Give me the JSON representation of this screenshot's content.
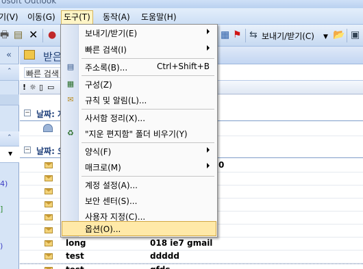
{
  "window": {
    "title": "osoft Outlook"
  },
  "menubar": {
    "items": [
      {
        "label": "기(V)"
      },
      {
        "label": "이동(G)"
      },
      {
        "label": "도구(T)"
      },
      {
        "label": "동작(A)"
      },
      {
        "label": "도움말(H)"
      }
    ]
  },
  "toolbar": {
    "send_receive_label": "보내기/받기(C)"
  },
  "nav_pane": {
    "collapse_glyph": "«",
    "items": [
      "4)",
      "]",
      ")"
    ]
  },
  "inbox": {
    "title_partial": "받은",
    "quick_search_partial": "빠른 검색",
    "groups": [
      {
        "label": "날짜: 지",
        "toggle": "−"
      },
      {
        "label": "날짜: 오",
        "toggle": "−"
      }
    ],
    "subject_fragment": "0",
    "messages": [
      {
        "from": "long",
        "subject": "018 ie7 gmail"
      },
      {
        "from": "test",
        "subject": "ddddd"
      },
      {
        "from": "test",
        "subject": "gfds"
      }
    ]
  },
  "tools_menu": {
    "items": [
      {
        "label": "보내기/받기(E)",
        "submenu": true
      },
      {
        "label": "빠른 검색(I)",
        "submenu": true
      },
      {
        "label": "주소록(B)...",
        "shortcut": "Ctrl+Shift+B",
        "icon": "address-book-icon"
      },
      {
        "label": "구성(Z)",
        "icon": "organize-icon"
      },
      {
        "label": "규칙 및 알림(L)...",
        "icon": "rules-icon"
      },
      {
        "label": "사서함 정리(X)..."
      },
      {
        "label": "\"지운 편지함\" 폴더 비우기(Y)",
        "icon": "empty-trash-icon"
      },
      {
        "label": "양식(F)",
        "submenu": true
      },
      {
        "label": "매크로(M)",
        "submenu": true
      },
      {
        "label": "계정 설정(A)..."
      },
      {
        "label": "보안 센터(S)..."
      },
      {
        "label": "사용자 지정(C)..."
      },
      {
        "label": "옵션(O)...",
        "highlighted": true
      }
    ]
  }
}
